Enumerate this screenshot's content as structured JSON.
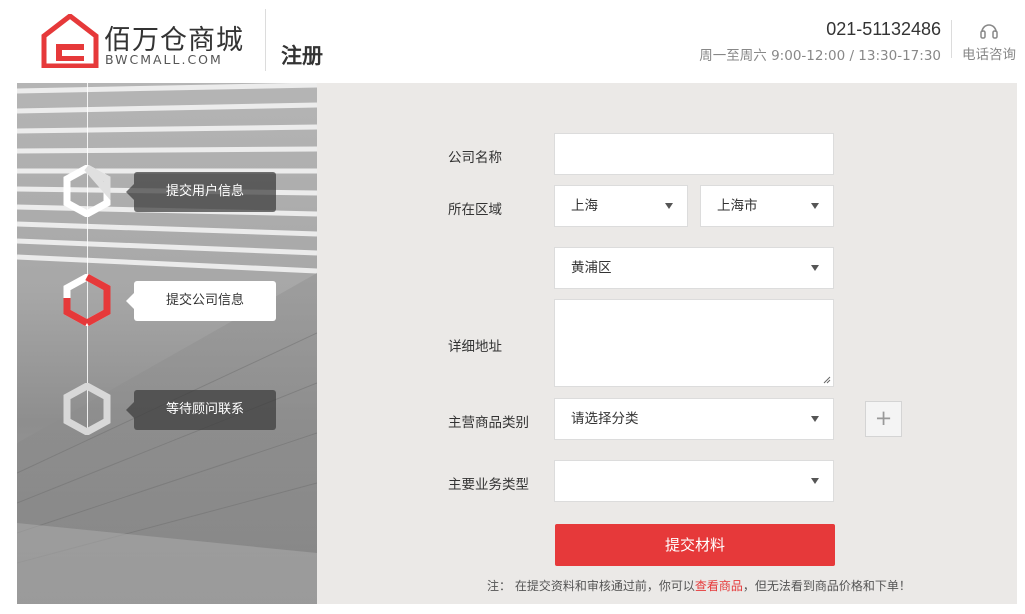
{
  "header": {
    "brand_cn": "佰万仓商城",
    "brand_en": "BWCMALL.COM",
    "page_title": "注册",
    "phone": "021-51132486",
    "hours": "周一至周六 9:00-12:00 / 13:30-17:30",
    "contact_label": "电话咨询"
  },
  "steps": [
    {
      "label": "提交用户信息",
      "state": "done"
    },
    {
      "label": "提交公司信息",
      "state": "active"
    },
    {
      "label": "等待顾问联系",
      "state": "pending"
    }
  ],
  "form": {
    "company_name_label": "公司名称",
    "company_name_value": "",
    "region_label": "所在区域",
    "province": "上海",
    "city": "上海市",
    "district": "黄浦区",
    "address_label": "详细地址",
    "address_value": "",
    "category_label": "主营商品类别",
    "category_value": "请选择分类",
    "business_type_label": "主要业务类型",
    "business_type_value": "",
    "add_button": "+",
    "submit_label": "提交材料"
  },
  "note": {
    "prefix": "注： 在提交资料和审核通过前，你可以",
    "link": "查看商品",
    "suffix": "，但无法看到商品价格和下单！"
  },
  "colors": {
    "accent": "#e6393a",
    "form_bg": "#ebe9e7",
    "step_active_ring": "#e6393a"
  },
  "icons": {
    "logo": "house-logo-icon",
    "contact": "headset-icon",
    "dropdown": "chevron-down-icon"
  }
}
